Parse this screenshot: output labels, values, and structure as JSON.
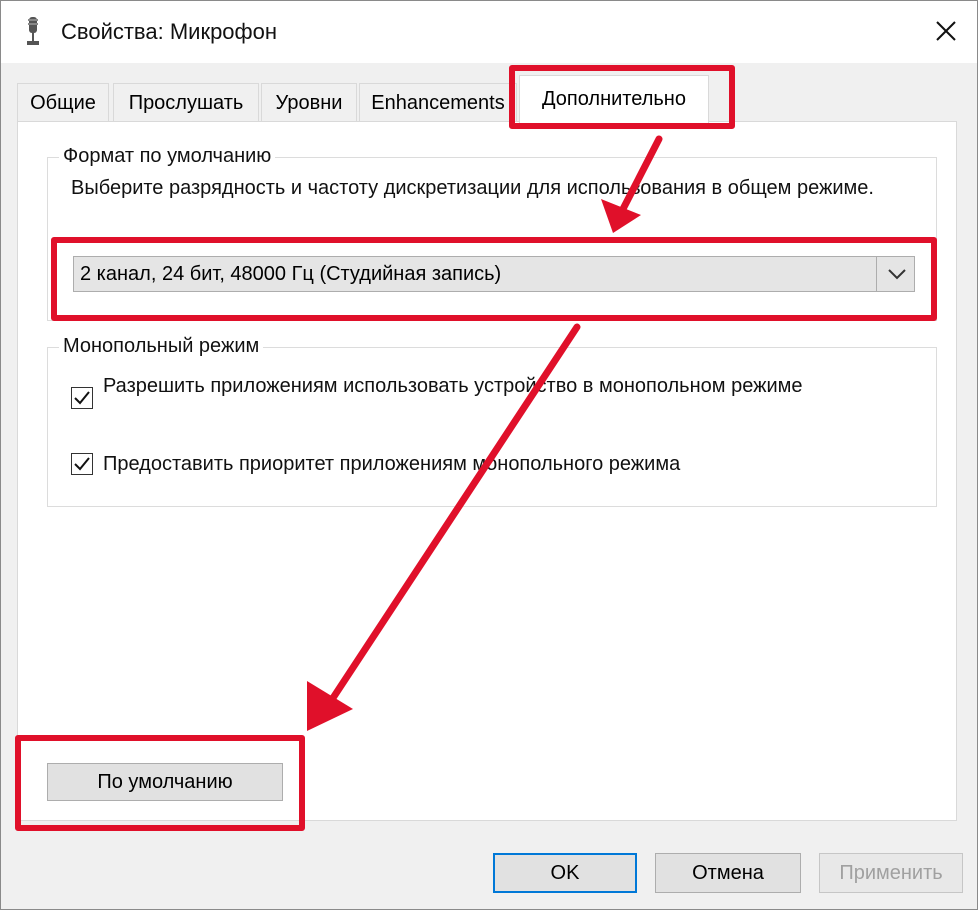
{
  "window": {
    "title": "Свойства: Микрофон"
  },
  "tabs": [
    {
      "label": "Общие"
    },
    {
      "label": "Прослушать"
    },
    {
      "label": "Уровни"
    },
    {
      "label": "Enhancements"
    },
    {
      "label": "Дополнительно",
      "active": true
    }
  ],
  "default_format": {
    "legend": "Формат по умолчанию",
    "description": "Выберите разрядность и частоту дискретизации для использования в общем режиме.",
    "selected_value": "2 канал, 24 бит, 48000 Гц (Студийная запись)"
  },
  "exclusive_mode": {
    "legend": "Монопольный режим",
    "options": [
      {
        "label": "Разрешить приложениям использовать устройство в монопольном режиме",
        "checked": true
      },
      {
        "label": "Предоставить приоритет приложениям монопольного режима",
        "checked": true
      }
    ]
  },
  "buttons": {
    "restore_defaults": "По умолчанию",
    "ok": "OK",
    "cancel": "Отмена",
    "apply": "Применить"
  },
  "colors": {
    "highlight": "#e0102a",
    "default_button_border": "#0078d7"
  }
}
